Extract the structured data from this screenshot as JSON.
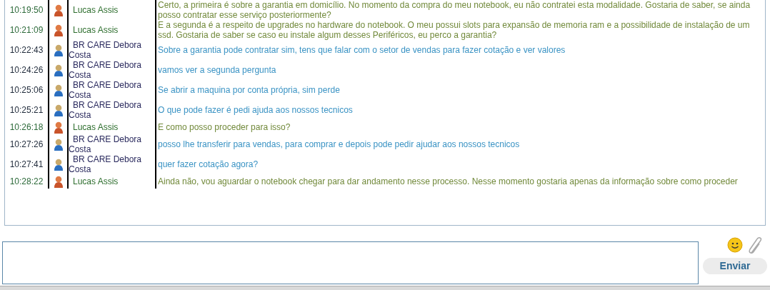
{
  "messages": [
    {
      "time": "10:19:50",
      "kind": "customer",
      "sender": "Lucas Assis",
      "text": "Certo, a primeira é sobre a garantia em domicílio. No momento da compra do meu notebook, eu não contratei esta modalidade. Gostaria de saber, se ainda posso contratar esse serviço posteriormente?"
    },
    {
      "time": "10:21:09",
      "kind": "customer",
      "sender": "Lucas Assis",
      "text": "E a segunda é a respeito de upgrades no hardware do notebook. O meu possui slots para expansão de memoria ram e a possibilidade de instalação de um ssd. Gostaria de saber se caso eu instale algum desses Periféricos, eu perco a garantia?"
    },
    {
      "time": "10:22:43",
      "kind": "agent",
      "sender": "BR CARE Debora Costa",
      "text": "Sobre a garantia pode contratar sim, tens que falar com o setor de vendas para fazer cotação e ver valores"
    },
    {
      "time": "10:24:26",
      "kind": "agent",
      "sender": "BR CARE Debora Costa",
      "text": "vamos ver a segunda pergunta"
    },
    {
      "time": "10:25:06",
      "kind": "agent",
      "sender": "BR CARE Debora Costa",
      "text": "Se abrir a maquina por conta própria, sim perde"
    },
    {
      "time": "10:25:21",
      "kind": "agent",
      "sender": "BR CARE Debora Costa",
      "text": "O que pode fazer é pedi ajuda aos nossos tecnicos"
    },
    {
      "time": "10:26:18",
      "kind": "customer",
      "sender": "Lucas Assis",
      "text": "E como posso proceder para isso?"
    },
    {
      "time": "10:27:26",
      "kind": "agent",
      "sender": "BR CARE Debora Costa",
      "text": "posso lhe transferir para vendas, para comprar e depois pode pedir ajudar aos nossos tecnicos"
    },
    {
      "time": "10:27:41",
      "kind": "agent",
      "sender": "BR CARE Debora Costa",
      "text": "quer fazer cotação agora?"
    },
    {
      "time": "10:28:22",
      "kind": "customer",
      "sender": "Lucas Assis",
      "text": "Ainda não, vou aguardar o notebook chegar para dar andamento nesse processo. Nesse momento gostaria apenas da informação sobre como proceder"
    }
  ],
  "send_button": "Enviar"
}
